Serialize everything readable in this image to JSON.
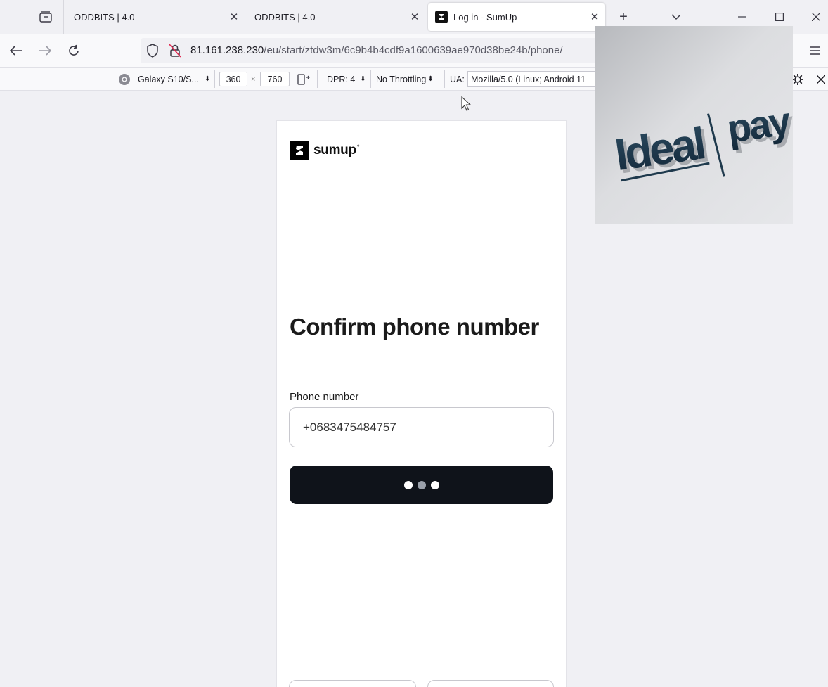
{
  "tabs": [
    {
      "title": "ODDBITS | 4.0",
      "active": false
    },
    {
      "title": "ODDBITS | 4.0",
      "active": false
    },
    {
      "title": "Log in - SumUp",
      "active": true
    }
  ],
  "address": {
    "host": "81.161.238.230",
    "path": "/eu/start/ztdw3m/6c9b4b4cdf9a1600639ae970d38be24b/phone/"
  },
  "rdm": {
    "device": "Galaxy S10/S...",
    "width": "360",
    "times": "×",
    "height": "760",
    "dpr": "DPR: 4",
    "throttling": "No Throttling",
    "ua_label": "UA:",
    "ua_value": "Mozilla/5.0 (Linux; Android 11"
  },
  "page": {
    "brand": "sumup",
    "brand_mark": "°",
    "heading": "Confirm phone number",
    "phone_label": "Phone number",
    "phone_value": "+0683475484757"
  },
  "overlay": {
    "text_left": "Ideal",
    "text_right": "pay"
  },
  "colors": {
    "button": "#0f131a",
    "chrome_bg": "#f0f0f4",
    "overlay_text": "#1f3a4d"
  }
}
